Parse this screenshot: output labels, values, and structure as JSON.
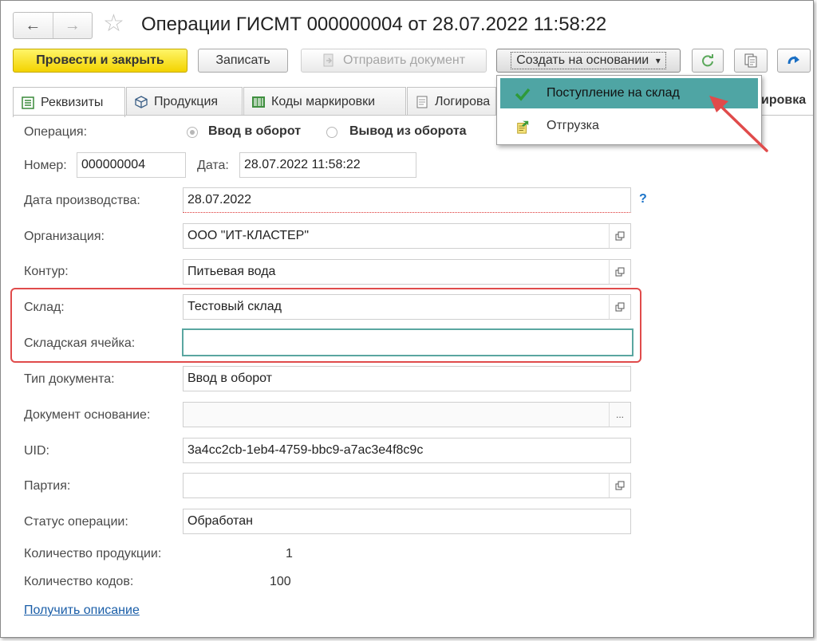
{
  "window": {
    "title": "Операции ГИСМТ 000000004 от 28.07.2022 11:58:22",
    "nav_back": "←",
    "nav_forward": "→",
    "star": "☆"
  },
  "toolbar": {
    "post_close": "Провести и закрыть",
    "save": "Записать",
    "send_document": "Отправить документ",
    "create_based": "Создать на основании",
    "dropdown_arrow": "▾"
  },
  "tabs": [
    {
      "label": "Реквизиты",
      "icon": "form-icon"
    },
    {
      "label": "Продукция",
      "icon": "cube-icon"
    },
    {
      "label": "Коды маркировки",
      "icon": "barcode-icon"
    },
    {
      "label": "Логирова",
      "icon": "log-icon"
    }
  ],
  "tab_overflow_text": "ировка",
  "dropdown_menu": {
    "items": [
      {
        "label": "Поступление на склад",
        "icon": "checkmark-icon",
        "highlighted": true
      },
      {
        "label": "Отгрузка",
        "icon": "shipment-icon",
        "highlighted": false
      }
    ]
  },
  "form": {
    "operation_label": "Операция:",
    "operation_options": [
      "Ввод в оборот",
      "Вывод из оборота"
    ],
    "operation_selected": "Ввод в оборот",
    "number_label": "Номер:",
    "number_value": "000000004",
    "date_label": "Дата:",
    "date_value": "28.07.2022 11:58:22",
    "production_date_label": "Дата производства:",
    "production_date_value": "28.07.2022",
    "help_mark": "?",
    "organization_label": "Организация:",
    "organization_value": "ООО \"ИТ-КЛАСТЕР\"",
    "contour_label": "Контур:",
    "contour_value": "Питьевая вода",
    "warehouse_label": "Склад:",
    "warehouse_value": "Тестовый склад",
    "cell_label": "Складская ячейка:",
    "cell_value": "",
    "doc_type_label": "Тип документа:",
    "doc_type_value": "Ввод в оборот",
    "base_doc_label": "Документ основание:",
    "base_doc_value": "",
    "base_doc_button": "...",
    "uid_label": "UID:",
    "uid_value": "3a4cc2cb-1eb4-4759-bbc9-a7ac3e4f8c9c",
    "batch_label": "Партия:",
    "batch_value": "",
    "status_label": "Статус операции:",
    "status_value": "Обработан",
    "product_qty_label": "Количество продукции:",
    "product_qty_value": "1",
    "codes_qty_label": "Количество кодов:",
    "codes_qty_value": "100",
    "get_description_link": "Получить описание"
  },
  "colors": {
    "primary_button": "#f3d300",
    "menu_highlight": "#4fa5a4",
    "annotation_red": "#e04b4b",
    "focus_border": "#5aa6a0",
    "link": "#1a5ea8"
  }
}
